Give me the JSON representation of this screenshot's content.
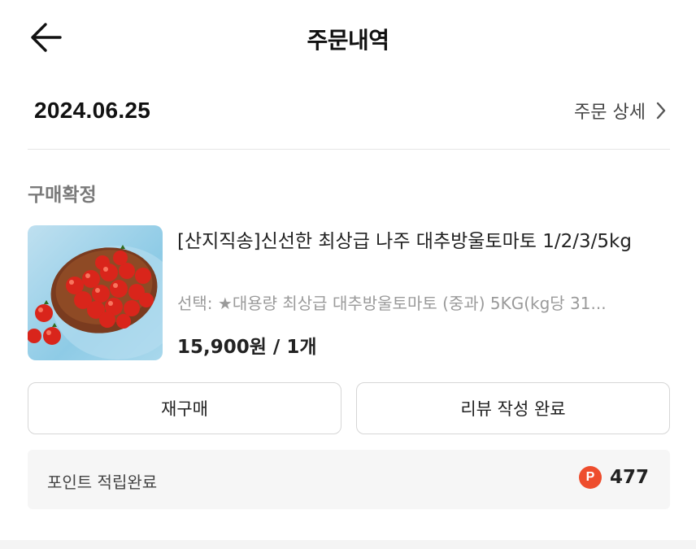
{
  "header": {
    "title": "주문내역",
    "back_icon": "arrow-left-icon"
  },
  "order": {
    "date": "2024.06.25",
    "detail_link": "주문 상세",
    "status": "구매확정"
  },
  "product": {
    "name": "[산지직송]신선한 최상급 나주 대추방울토마토 1/2/3/5kg",
    "option": "선택: ★대용량 최상급 대추방울토마토 (중과) 5KG(kg당 31...",
    "price": "15,900원 / 1개",
    "image_icon": "cherry-tomato-photo"
  },
  "actions": {
    "rebuy_label": "재구매",
    "review_label": "리뷰 작성 완료"
  },
  "points": {
    "label": "포인트 적립완료",
    "icon_letter": "P",
    "value": "477",
    "icon_color": "#ee4d2d"
  }
}
